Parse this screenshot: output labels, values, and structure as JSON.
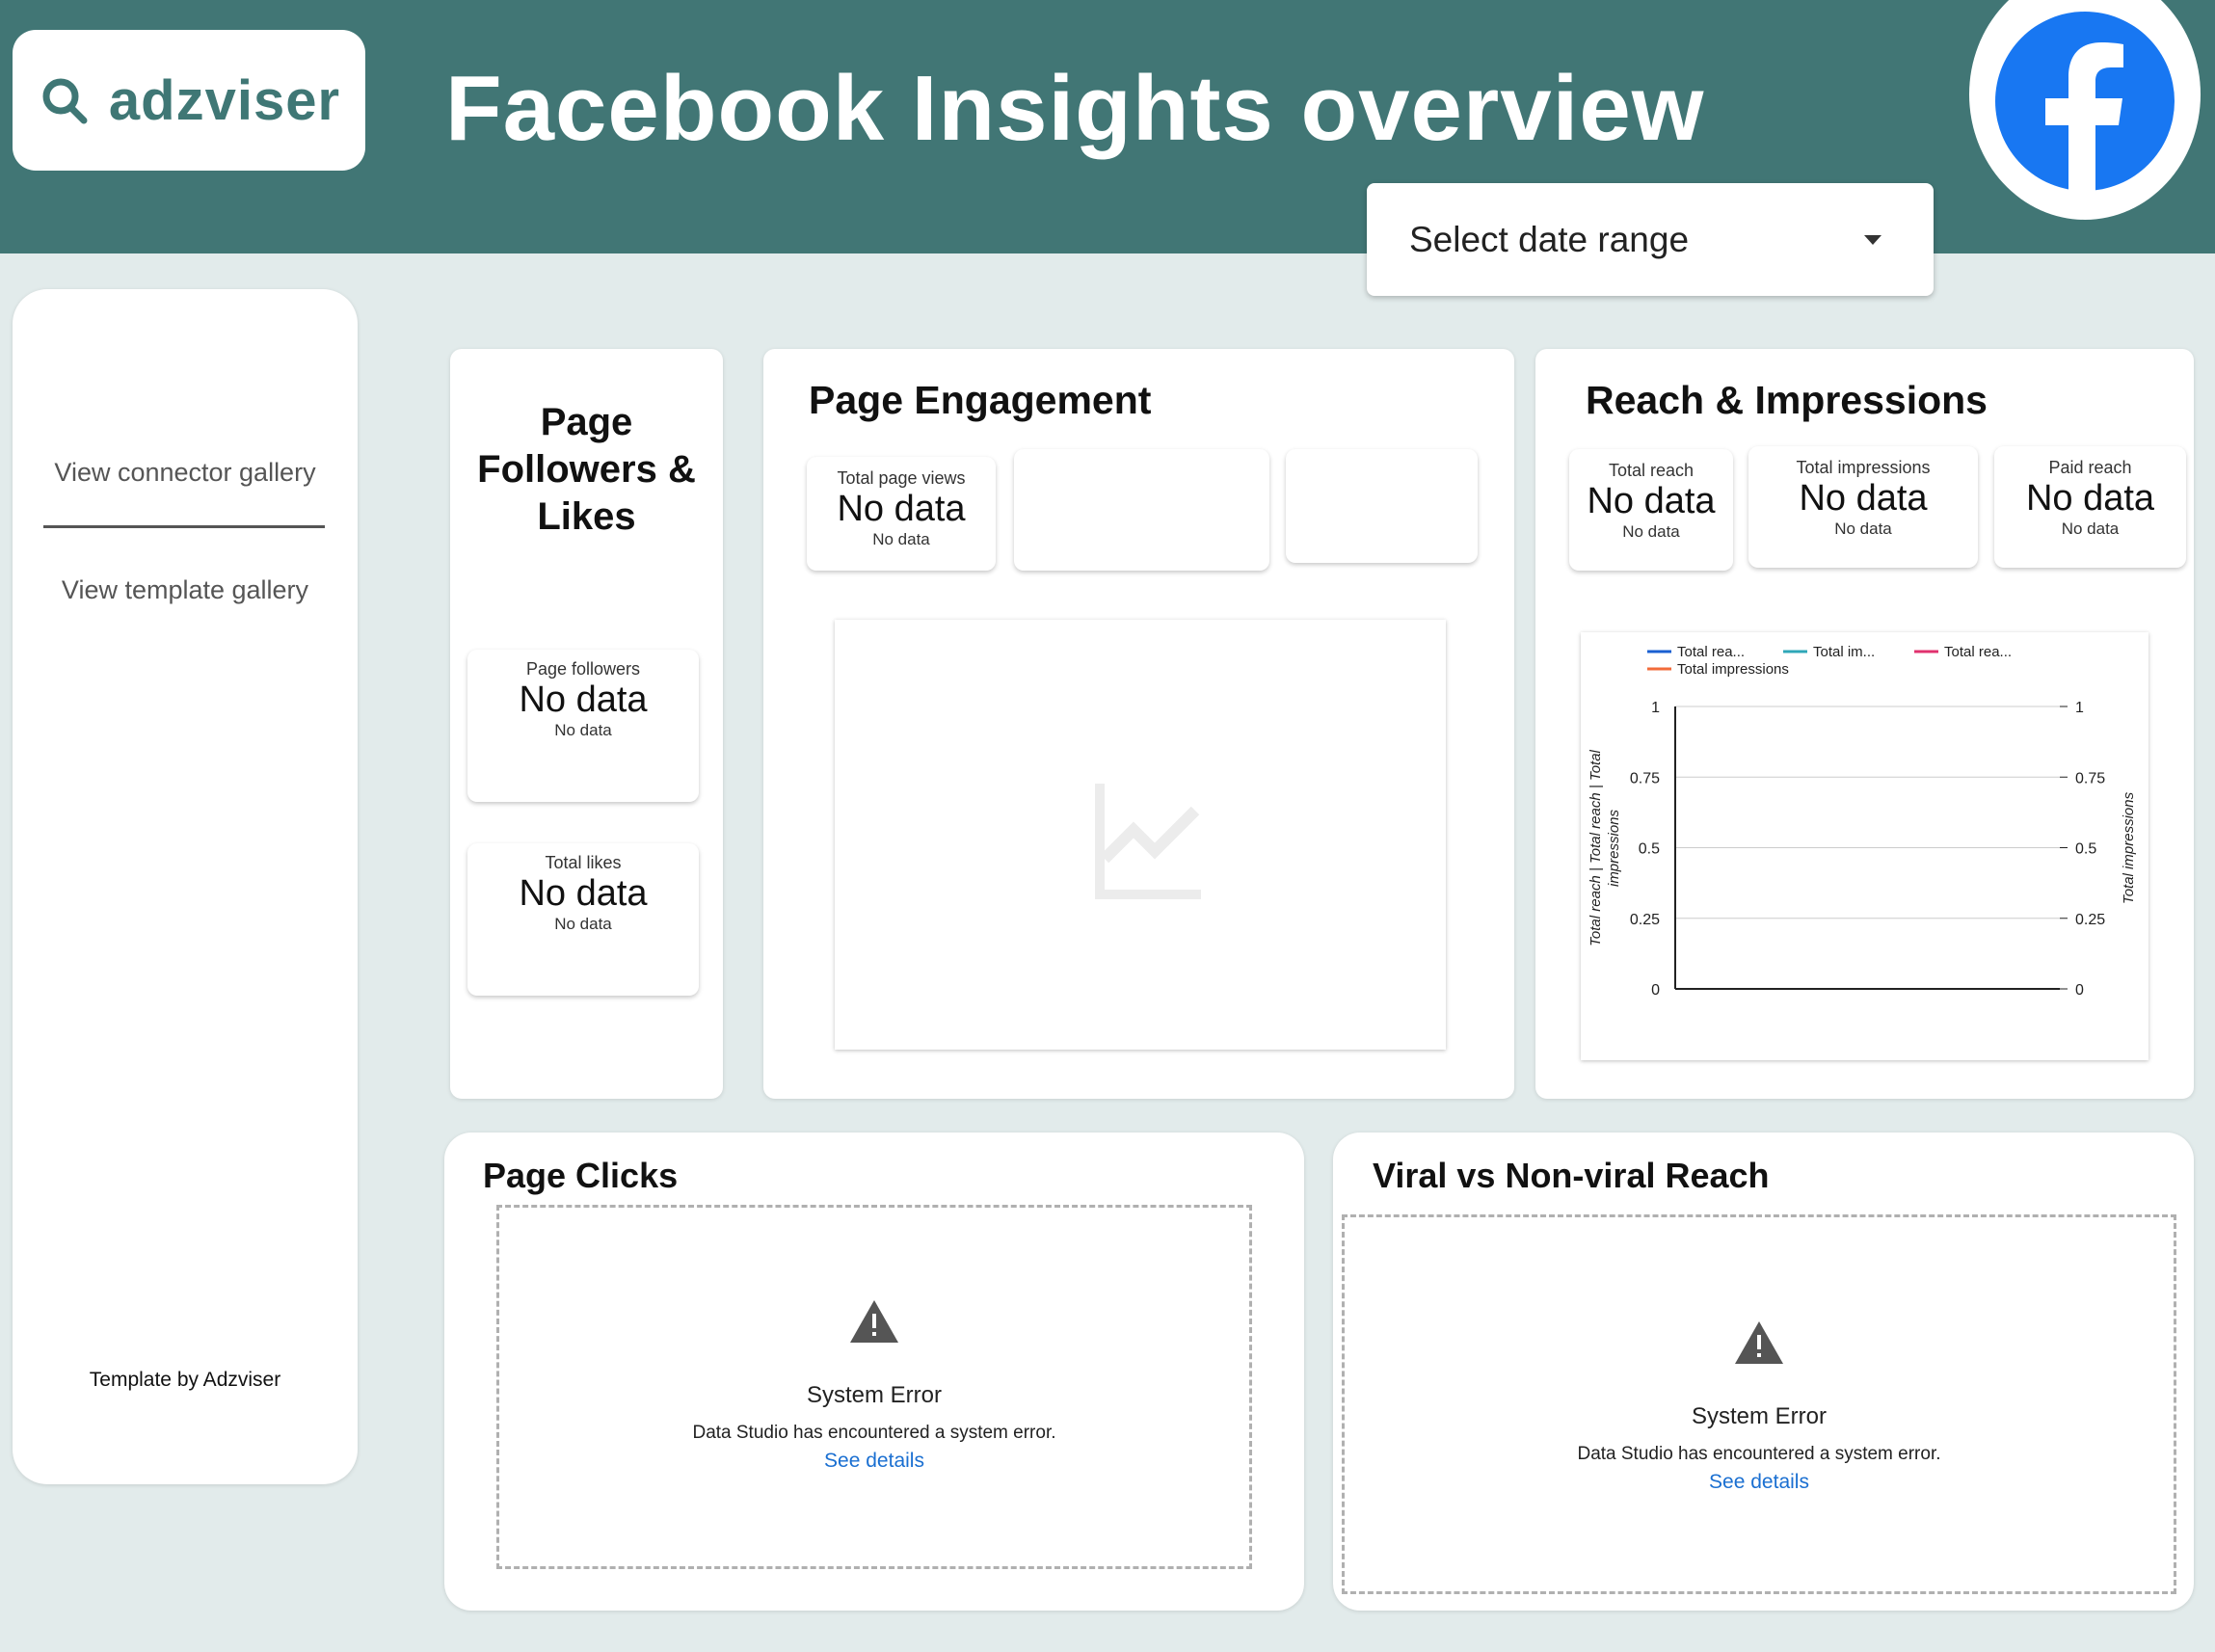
{
  "header": {
    "brand": "adzviser",
    "title": "Facebook Insights overview",
    "date_range_label": "Select date range"
  },
  "sidebar": {
    "links": [
      "View connector gallery",
      "View template gallery"
    ],
    "footer": "Template by Adzviser"
  },
  "followers": {
    "title_lines": [
      "Page",
      "Followers &",
      "Likes"
    ],
    "cards": [
      {
        "label": "Page followers",
        "value": "No data",
        "sub": "No data"
      },
      {
        "label": "Total likes",
        "value": "No data",
        "sub": "No data"
      }
    ]
  },
  "engagement": {
    "title": "Page Engagement",
    "card": {
      "label": "Total page views",
      "value": "No data",
      "sub": "No data"
    }
  },
  "reach": {
    "title": "Reach & Impressions",
    "cards": [
      {
        "label": "Total reach",
        "value": "No data",
        "sub": "No data"
      },
      {
        "label": "Total impressions",
        "value": "No data",
        "sub": "No data"
      },
      {
        "label": "Paid reach",
        "value": "No data",
        "sub": "No data"
      }
    ]
  },
  "chart_data": {
    "type": "line",
    "series": [
      {
        "name": "Total rea...",
        "color": "#1a5fd1",
        "values": []
      },
      {
        "name": "Total im...",
        "color": "#2fa7b8",
        "values": []
      },
      {
        "name": "Total rea...",
        "color": "#e0316e",
        "values": []
      },
      {
        "name": "Total impressions",
        "color": "#f26b3a",
        "values": []
      }
    ],
    "yticks": [
      "1",
      "0.75",
      "0.5",
      "0.25",
      "0"
    ],
    "ylim": [
      0,
      1
    ],
    "y2lim": [
      0,
      1
    ],
    "ylabel_lines": [
      "Total reach | Total reach | Total",
      "impressions"
    ],
    "y2label": "Total impressions",
    "grid": true,
    "legend": "top"
  },
  "clicks": {
    "title": "Page Clicks",
    "error_title": "System Error",
    "error_msg": "Data Studio has encountered a system error.",
    "error_link": "See details"
  },
  "viral": {
    "title": "Viral vs Non-viral Reach",
    "error_title": "System Error",
    "error_msg": "Data Studio has encountered a system error.",
    "error_link": "See details"
  }
}
